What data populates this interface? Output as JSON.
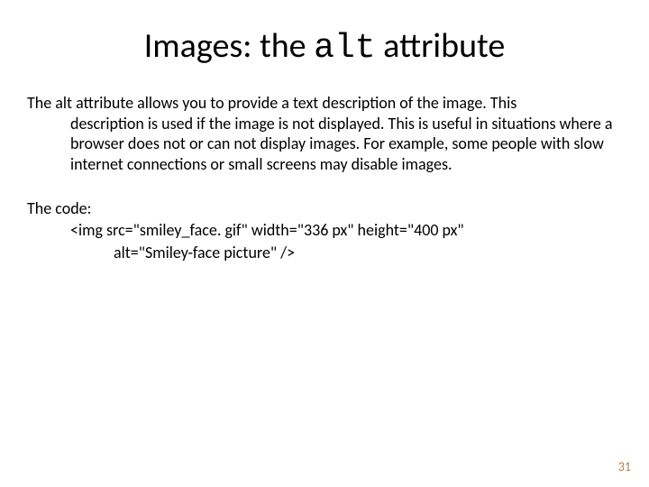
{
  "title_prefix": "Images: the ",
  "title_code": "alt",
  "title_suffix": " attribute",
  "paragraph_first": "The alt attribute allows you to provide a text description of the image.  This",
  "paragraph_rest": "description is used if the image is not displayed.  This is useful in situations where a browser does not or can not display images. For example, some people with slow internet connections or small screens may disable images.",
  "code_lead": "The code:",
  "code_line1": "<img src=\"smiley_face. gif\" width=\"336 px\" height=\"400 px\"",
  "code_line2": "alt=\"Smiley-face picture\" />",
  "page_number": "31"
}
